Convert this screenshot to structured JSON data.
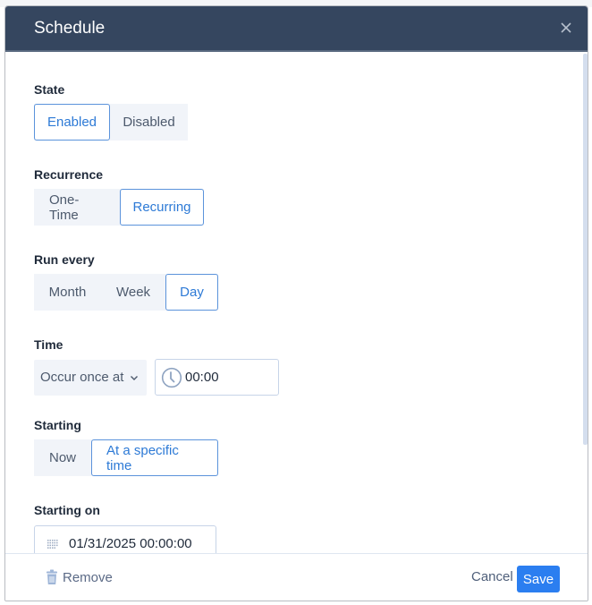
{
  "dialog": {
    "title": "Schedule",
    "close_icon": "close-icon"
  },
  "state": {
    "label": "State",
    "options": [
      "Enabled",
      "Disabled"
    ],
    "selected": "Enabled"
  },
  "recurrence": {
    "label": "Recurrence",
    "options": [
      "One-Time",
      "Recurring"
    ],
    "selected": "Recurring"
  },
  "run_every": {
    "label": "Run every",
    "options": [
      "Month",
      "Week",
      "Day"
    ],
    "selected": "Day"
  },
  "time": {
    "label": "Time",
    "mode": "Occur once at",
    "value": "00:00",
    "icon": "clock-icon"
  },
  "starting": {
    "label": "Starting",
    "options": [
      "Now",
      "At a specific time"
    ],
    "selected": "At a specific time"
  },
  "starting_on": {
    "label": "Starting on",
    "value": "01/31/2025 00:00:00",
    "icon": "calendar-icon"
  },
  "footer": {
    "remove_label": "Remove",
    "cancel_label": "Cancel",
    "save_label": "Save"
  },
  "colors": {
    "header_bg": "#35465f",
    "accent": "#2b7ef0",
    "active_text": "#2d7ad6",
    "segment_bg": "#f1f4f9"
  }
}
